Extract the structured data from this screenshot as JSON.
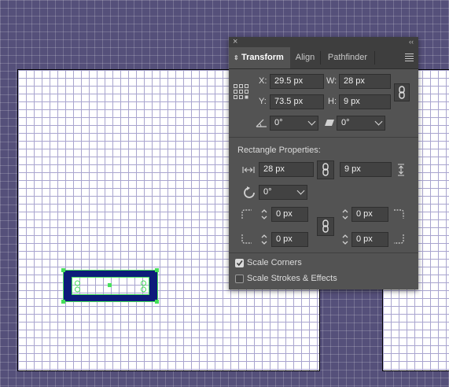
{
  "panel": {
    "tabs": [
      {
        "label": "Transform",
        "active": true
      },
      {
        "label": "Align",
        "active": false
      },
      {
        "label": "Pathfinder",
        "active": false
      }
    ],
    "close_glyph": "×",
    "collapse_glyph": "‹‹",
    "transform": {
      "x_label": "X:",
      "x_value": "29.5 px",
      "y_label": "Y:",
      "y_value": "73.5 px",
      "w_label": "W:",
      "w_value": "28 px",
      "h_label": "H:",
      "h_value": "9 px",
      "angle_value": "0°",
      "shear_value": "0°"
    },
    "rectangle_properties": {
      "title": "Rectangle Properties:",
      "width_value": "28 px",
      "height_value": "9 px",
      "rotation_value": "0°",
      "corner_tl": "0 px",
      "corner_tr": "0 px",
      "corner_bl": "0 px",
      "corner_br": "0 px"
    },
    "options": {
      "scale_corners_label": "Scale Corners",
      "scale_corners_checked": true,
      "scale_strokes_label": "Scale Strokes & Effects",
      "scale_strokes_checked": false
    }
  },
  "colors": {
    "canvas_bg": "#55507a",
    "panel_bg": "#535353",
    "shape_fill": "#0d1b7a",
    "selection": "#46e05a"
  },
  "icons": [
    "reference-point-icon",
    "link-icon",
    "angle-icon",
    "shear-icon",
    "width-icon",
    "height-icon",
    "rotate-icon",
    "corner-icon",
    "checkbox-icon",
    "panel-menu-icon"
  ]
}
